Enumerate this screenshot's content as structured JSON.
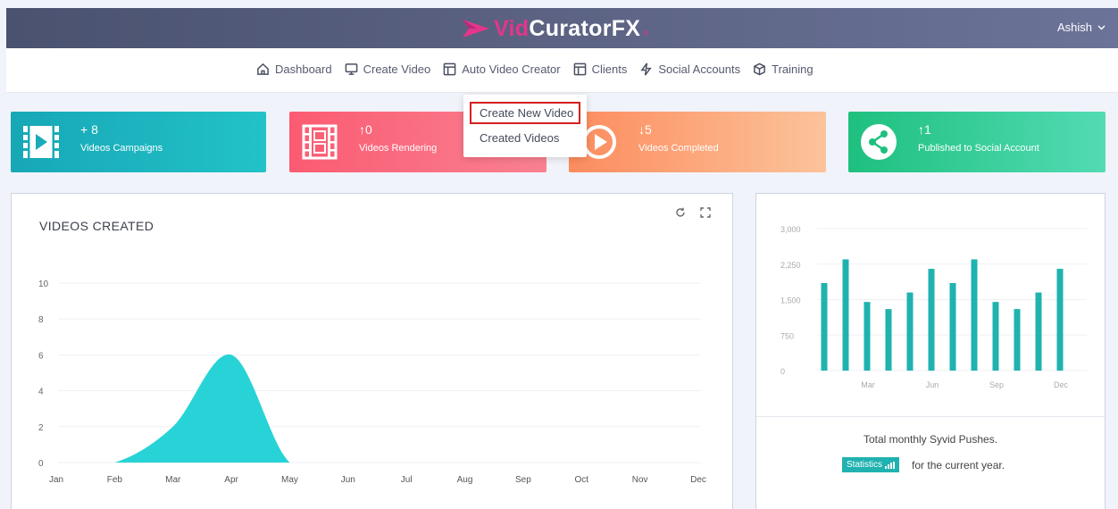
{
  "header": {
    "logo_vid": "Vid",
    "logo_rest": "CuratorFX",
    "logo_suffix": ".io",
    "user_name": "Ashish"
  },
  "nav": {
    "items": [
      {
        "label": "Dashboard",
        "icon": "home-icon"
      },
      {
        "label": "Create Video",
        "icon": "monitor-icon"
      },
      {
        "label": "Auto Video Creator",
        "icon": "layout-icon"
      },
      {
        "label": "Clients",
        "icon": "layout-icon"
      },
      {
        "label": "Social Accounts",
        "icon": "lightning-icon"
      },
      {
        "label": "Training",
        "icon": "box-icon"
      }
    ]
  },
  "dropdown": {
    "items": [
      "Create New Video",
      "Created Videos"
    ]
  },
  "cards": [
    {
      "value": "+ 8",
      "label": "Videos Campaigns",
      "icon": "film-strip-icon"
    },
    {
      "value": "↑0",
      "label": "Videos Rendering",
      "icon": "film-frame-icon"
    },
    {
      "value": "↓5",
      "label": "Videos Completed",
      "icon": "play-circle-icon"
    },
    {
      "value": "↑1",
      "label": "Published to Social Account",
      "icon": "share-icon"
    }
  ],
  "videos_panel": {
    "title": "VIDEOS CREATED"
  },
  "pushes_panel": {
    "footnote": "Total monthly Syvid Pushes.",
    "badge": "Statistics",
    "suffix": "for the current year."
  },
  "colors": {
    "accent": "#1fb2b0",
    "area": "#27d3d6",
    "header": "#5a6181",
    "brand": "#e2368a"
  },
  "chart_data": [
    {
      "type": "area",
      "title": "VIDEOS CREATED",
      "categories": [
        "Jan",
        "Feb",
        "Mar",
        "Apr",
        "May",
        "Jun",
        "Jul",
        "Aug",
        "Sep",
        "Oct",
        "Nov",
        "Dec"
      ],
      "values": [
        0,
        0,
        2,
        6,
        0,
        0,
        0,
        0,
        0,
        0,
        0,
        0
      ],
      "yticks": [
        0,
        2,
        4,
        6,
        8,
        10
      ],
      "ylim": [
        0,
        10
      ],
      "grid": true
    },
    {
      "type": "bar",
      "categories": [
        "Jan",
        "Feb",
        "Mar",
        "Apr",
        "May",
        "Jun",
        "Jul",
        "Aug",
        "Sep",
        "Oct",
        "Nov",
        "Dec"
      ],
      "xtick_labels": [
        "Mar",
        "Jun",
        "Sep",
        "Dec"
      ],
      "values": [
        1850,
        2350,
        1450,
        1300,
        1650,
        2150,
        1850,
        2350,
        1450,
        1300,
        1650,
        2150
      ],
      "ytick_labels": [
        "0",
        "750",
        "1,500",
        "2,250",
        "3,000"
      ],
      "yticks": [
        0,
        750,
        1500,
        2250,
        3000
      ],
      "ylim": [
        0,
        3000
      ],
      "grid": true
    }
  ]
}
